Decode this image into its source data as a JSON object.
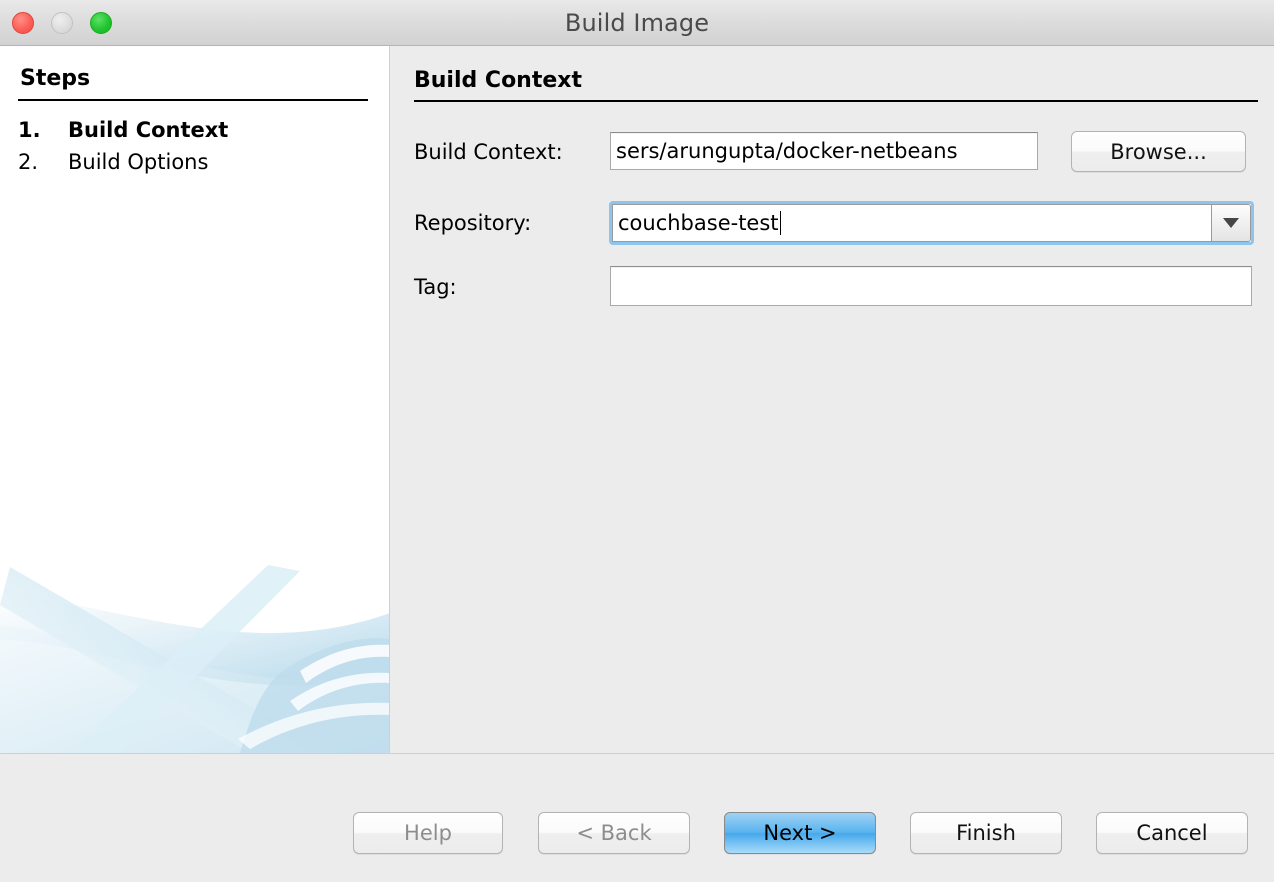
{
  "window": {
    "title": "Build Image",
    "traffic_lights": [
      {
        "name": "close",
        "color": "#fc5f58"
      },
      {
        "name": "minimize",
        "color": "#dcdcdc"
      },
      {
        "name": "zoom",
        "color": "#23c52f"
      }
    ]
  },
  "sidebar": {
    "heading": "Steps",
    "steps": [
      {
        "number": "1.",
        "label": "Build Context",
        "active": true
      },
      {
        "number": "2.",
        "label": "Build Options",
        "active": false
      }
    ]
  },
  "panel": {
    "heading": "Build Context",
    "fields": {
      "build_context": {
        "label": "Build Context:",
        "value": "sers/arungupta/docker-netbeans",
        "placeholder": ""
      },
      "repository": {
        "label": "Repository:",
        "value": "couchbase-test",
        "placeholder": "",
        "focused": true,
        "dropdown_icon": "chevron-down-icon"
      },
      "tag": {
        "label": "Tag:",
        "value": "",
        "placeholder": ""
      }
    },
    "browse_button": "Browse..."
  },
  "buttons": {
    "help": {
      "label": "Help",
      "enabled": false
    },
    "back": {
      "label": "< Back",
      "enabled": false
    },
    "next": {
      "label": "Next >",
      "enabled": true,
      "default": true
    },
    "finish": {
      "label": "Finish",
      "enabled": true
    },
    "cancel": {
      "label": "Cancel",
      "enabled": true
    }
  },
  "colors": {
    "focus_ring": "#8cc6ef",
    "default_button": "#47a9ec",
    "panel_bg": "#ececec",
    "sidebar_bg": "#ffffff",
    "swoosh": "#bcdcec"
  }
}
